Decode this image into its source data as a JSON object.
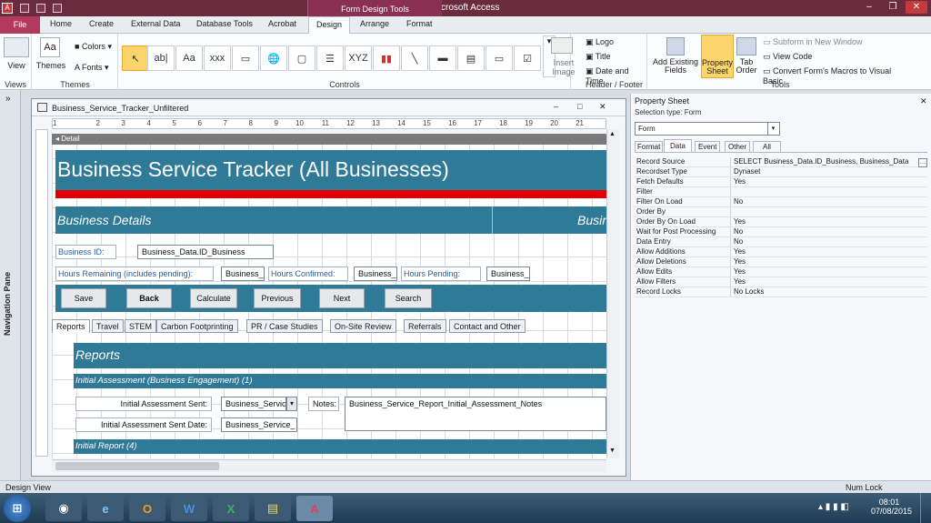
{
  "app": {
    "title": "Microsoft Access",
    "contextual_group": "Form Design Tools"
  },
  "ribbon": {
    "tabs": [
      "File",
      "Home",
      "Create",
      "External Data",
      "Database Tools",
      "Acrobat",
      "Design",
      "Arrange",
      "Format"
    ],
    "groups": {
      "views": {
        "label": "Views",
        "view_button": "View"
      },
      "themes": {
        "label": "Themes",
        "themes_button": "Themes",
        "colors": "Colors",
        "fonts": "Fonts"
      },
      "controls": {
        "label": "Controls",
        "insert_image": "Insert Image"
      },
      "header_footer": {
        "label": "Header / Footer",
        "logo": "Logo",
        "title": "Title",
        "date_time": "Date and Time"
      },
      "tools": {
        "label": "Tools",
        "add_existing_fields": "Add Existing Fields",
        "property_sheet": "Property Sheet",
        "tab_order": "Tab Order",
        "subform_new_window": "Subform in New Window",
        "view_code": "View Code",
        "convert_macros": "Convert Form's Macros to Visual Basic"
      }
    }
  },
  "nav_pane": {
    "label": "Navigation Pane"
  },
  "form_window": {
    "title": "Business_Service_Tracker_Unfiltered",
    "ruler_ticks": [
      "1",
      "2",
      "3",
      "4",
      "5",
      "6",
      "7",
      "8",
      "9",
      "10",
      "11",
      "12",
      "13",
      "14",
      "15",
      "16",
      "17",
      "18",
      "19",
      "20",
      "21"
    ],
    "section": "Detail",
    "header_title": "Business Service Tracker (All Businesses)",
    "business_details": "Business Details",
    "business_details_cut": "Busin",
    "labels": {
      "business_id": "Business ID:",
      "hours_remaining": "Hours Remaining (includes pending):",
      "hours_confirmed": "Hours Confirmed:",
      "hours_pending": "Hours Pending:"
    },
    "fields": {
      "business_id": "Business_Data.ID_Business",
      "hours_remaining": "Business_",
      "hours_confirmed": "Business_",
      "hours_pending": "Business_"
    },
    "buttons": [
      "Save",
      "Back",
      "Calculate",
      "Previous",
      "Next",
      "Search"
    ],
    "tabs": [
      "Reports",
      "Travel",
      "STEM",
      "Carbon Footprinting",
      "PR / Case Studies",
      "On-Site Review",
      "Referrals",
      "Contact and Other"
    ],
    "reports": {
      "heading": "Reports",
      "initial_assessment": "Initial Assessment (Business Engagement) (1)",
      "initial_assessment_sent_label": "Initial Assessment Sent:",
      "initial_assessment_sent_value": "Business_Servic",
      "initial_assessment_sent_date_label": "Initial Assessment Sent Date:",
      "initial_assessment_sent_date_value": "Business_Service_",
      "notes_label": "Notes:",
      "notes_value": "Business_Service_Report_Initial_Assessment_Notes",
      "initial_report": "Initial Report (4)"
    }
  },
  "property_sheet": {
    "title": "Property Sheet",
    "selection_type_label": "Selection type:",
    "selection_type": "Form",
    "selected_object": "Form",
    "tabs": [
      "Format",
      "Data",
      "Event",
      "Other",
      "All"
    ],
    "active_tab": "Data",
    "rows": [
      {
        "k": "Record Source",
        "v": "SELECT Business_Data.ID_Business, Business_Data"
      },
      {
        "k": "Recordset Type",
        "v": "Dynaset"
      },
      {
        "k": "Fetch Defaults",
        "v": "Yes"
      },
      {
        "k": "Filter",
        "v": ""
      },
      {
        "k": "Filter On Load",
        "v": "No"
      },
      {
        "k": "Order By",
        "v": ""
      },
      {
        "k": "Order By On Load",
        "v": "Yes"
      },
      {
        "k": "Wait for Post Processing",
        "v": "No"
      },
      {
        "k": "Data Entry",
        "v": "No"
      },
      {
        "k": "Allow Additions",
        "v": "Yes"
      },
      {
        "k": "Allow Deletions",
        "v": "Yes"
      },
      {
        "k": "Allow Edits",
        "v": "Yes"
      },
      {
        "k": "Allow Filters",
        "v": "Yes"
      },
      {
        "k": "Record Locks",
        "v": "No Locks"
      }
    ]
  },
  "status_bar": {
    "left": "Design View",
    "right": "Num Lock"
  },
  "taskbar": {
    "time": "08:01",
    "date": "07/08/2015"
  },
  "colors": {
    "accent": "#2f7a96",
    "title_bar": "#6b2b3f",
    "red_band": "#e00000"
  }
}
